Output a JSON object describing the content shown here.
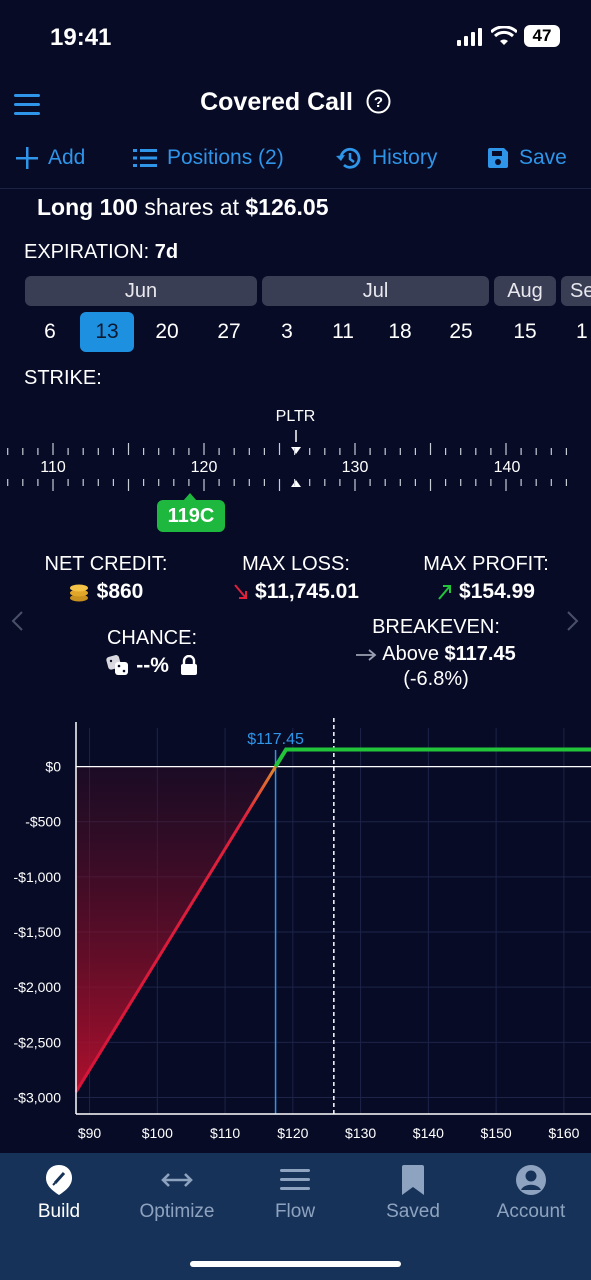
{
  "status_bar": {
    "time": "19:41",
    "battery": "47"
  },
  "header": {
    "title": "Covered Call",
    "help_icon": "question-circle-icon",
    "menu_icon": "hamburger-icon"
  },
  "toolbar": {
    "add_label": "Add",
    "positions_label": "Positions (2)",
    "history_label": "History",
    "save_label": "Save"
  },
  "position": {
    "prefix": "Long",
    "shares": "100",
    "middle": "shares at",
    "price": "$126.05"
  },
  "expiration": {
    "label_prefix": "EXPIRATION:",
    "label_value": "7d",
    "months": [
      "Jun",
      "Jul",
      "Aug",
      "Se"
    ],
    "days": [
      "6",
      "13",
      "20",
      "27",
      "3",
      "11",
      "18",
      "25",
      "15",
      "1"
    ],
    "selected_day": "13"
  },
  "strike": {
    "label": "STRIKE:",
    "ticker": "PLTR",
    "ticks": [
      "110",
      "120",
      "130",
      "140"
    ],
    "selected": "119C"
  },
  "stats": {
    "net_credit_label": "NET CREDIT:",
    "net_credit_value": "$860",
    "max_loss_label": "MAX LOSS:",
    "max_loss_value": "$11,745.01",
    "max_profit_label": "MAX PROFIT:",
    "max_profit_value": "$154.99",
    "chance_label": "CHANCE:",
    "chance_value": "--%",
    "breakeven_label": "BREAKEVEN:",
    "breakeven_prefix": "Above",
    "breakeven_value": "$117.45",
    "breakeven_pct": "(-6.8%)"
  },
  "colors": {
    "accent": "#2e95e8",
    "profit": "#22c43a",
    "loss": "#e0213c",
    "badge": "#1fb83e"
  },
  "chart_data": {
    "type": "line",
    "x": [
      88,
      117.45,
      119,
      164
    ],
    "series": [
      {
        "values": [
          -2950,
          0,
          154.99,
          154.99
        ]
      }
    ],
    "xlim": [
      88,
      164
    ],
    "ylim": [
      -3150,
      350
    ],
    "xticks": [
      "$90",
      "$100",
      "$110",
      "$120",
      "$130",
      "$140",
      "$150",
      "$160"
    ],
    "xtick_values": [
      90,
      100,
      110,
      120,
      130,
      140,
      150,
      160
    ],
    "yticks": [
      "$0",
      "-$500",
      "-$1,000",
      "-$1,500",
      "-$2,000",
      "-$2,500",
      "-$3,000"
    ],
    "ytick_values": [
      0,
      -500,
      -1000,
      -1500,
      -2000,
      -2500,
      -3000
    ],
    "breakeven_marker": {
      "x": 117.45,
      "label": "$117.45"
    },
    "current_price_marker": {
      "x": 126.05
    },
    "grid": true
  },
  "tabbar": {
    "items": [
      {
        "label": "Build"
      },
      {
        "label": "Optimize"
      },
      {
        "label": "Flow"
      },
      {
        "label": "Saved"
      },
      {
        "label": "Account"
      }
    ]
  }
}
